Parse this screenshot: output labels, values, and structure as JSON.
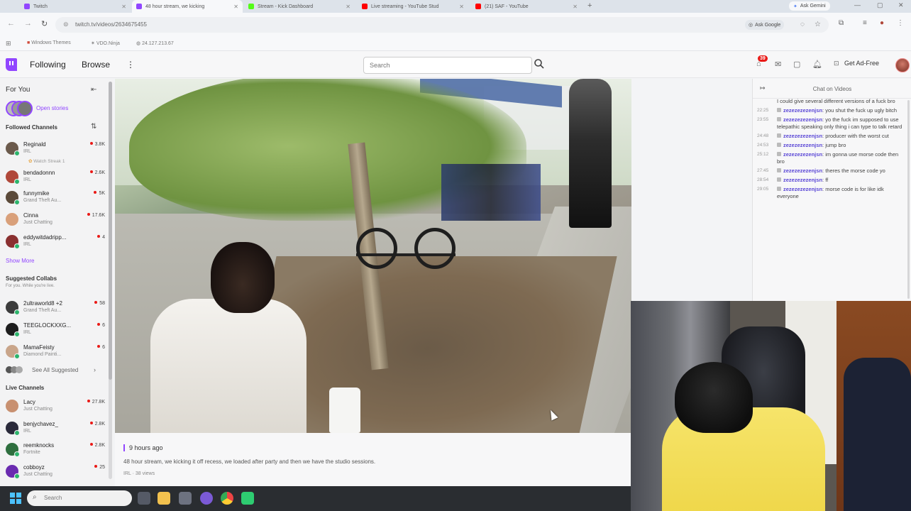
{
  "browser": {
    "tabs": [
      {
        "label": "Twitch",
        "active": false,
        "color": "#9146ff"
      },
      {
        "label": "48 hour stream, we kicking",
        "active": true,
        "color": "#9146ff"
      },
      {
        "label": "Stream - Kick Dashboard",
        "active": false,
        "color": "#53fc18"
      },
      {
        "label": "Live streaming - YouTube Stud",
        "active": false,
        "color": "#ff0000"
      },
      {
        "label": "(21) SAF - YouTube",
        "active": false,
        "color": "#ff0000"
      }
    ],
    "new_tab": "+",
    "ask_gemini": "Ask Gemini",
    "url": "twitch.tv/videos/2634675455",
    "ask_google": "Ask Google",
    "bookmarks": [
      {
        "label": "Windows Themes"
      },
      {
        "label": "VDO.Ninja"
      },
      {
        "label": "24.127.213.67"
      }
    ]
  },
  "twitch_nav": {
    "following": "Following",
    "browse": "Browse",
    "more": "⋮",
    "search_placeholder": "Search",
    "notif_count": "39",
    "ad_free": "Get Ad-Free"
  },
  "sidebar": {
    "for_you": "For You",
    "open_stories": "Open stories",
    "followed_title": "Followed Channels",
    "followed": [
      {
        "name": "Reginald",
        "game": "IRL",
        "extra": "Watch Streak 1",
        "viewers": "3.8K",
        "color": "#6b5a4c"
      },
      {
        "name": "bendadonnn",
        "game": "IRL",
        "viewers": "2.6K",
        "color": "#b0483a"
      },
      {
        "name": "funnymike",
        "game": "Grand Theft Au...",
        "viewers": "5K",
        "color": "#5b4a3a"
      },
      {
        "name": "Cinna",
        "game": "Just Chatting",
        "viewers": "17.6K",
        "color": "#d9a07a"
      },
      {
        "name": "eddywitdadripp...",
        "game": "IRL",
        "viewers": "4",
        "color": "#8a3030"
      }
    ],
    "show_more": "Show More",
    "suggested_title": "Suggested Collabs",
    "suggested_sub": "For you. While you're live.",
    "suggested": [
      {
        "name": "2ultraworld8 +2",
        "game": "Grand Theft Au...",
        "viewers": "58",
        "color": "#3c3c3c"
      },
      {
        "name": "TEEGLOCKXXG...",
        "game": "IRL",
        "viewers": "6",
        "color": "#1d1d1d"
      },
      {
        "name": "MamaFeisty",
        "game": "Diamond Painti...",
        "viewers": "6",
        "color": "#c9a58a"
      }
    ],
    "see_all": "See All Suggested",
    "live_title": "Live Channels",
    "live": [
      {
        "name": "Lacy",
        "game": "Just Chatting",
        "viewers": "27.8K",
        "color": "#c89070"
      },
      {
        "name": "benjychavez_",
        "game": "IRL",
        "viewers": "2.8K",
        "color": "#2a2a3a"
      },
      {
        "name": "reemknocks",
        "game": "Fortnite",
        "viewers": "2.8K",
        "color": "#2e6e3e"
      },
      {
        "name": "cobboyz",
        "game": "Just Chatting",
        "viewers": "25",
        "color": "#6a2bb0"
      }
    ]
  },
  "video_info": {
    "time_ago": "9 hours ago",
    "title": "48 hour stream, we kicking it off recess, we loaded after party and then we have the studio sessions.",
    "meta": "IRL · 38 views"
  },
  "chat": {
    "header": "Chat on Videos",
    "messages": [
      {
        "ts": "",
        "user": "",
        "text": "I could give several different versions of a fuck bro"
      },
      {
        "ts": "22:25",
        "user": "zezezezezenjsn",
        "text": ": you shut the fuck up ugly bitch"
      },
      {
        "ts": "23:55",
        "user": "zezezezezenjsn",
        "text": ": yo the fuck im supposed to use telepathic speaking only thing i can type to talk retard"
      },
      {
        "ts": "24:48",
        "user": "zezezezezenjsn",
        "text": ": producer with the worst cut"
      },
      {
        "ts": "24:53",
        "user": "zezezezezenjsn",
        "text": ": jump bro"
      },
      {
        "ts": "25:12",
        "user": "zezezezezenjsn",
        "text": ": im gonna use morse code then bro"
      },
      {
        "ts": "27:45",
        "user": "zezezezezenjsn",
        "text": ": theres the morse code yo"
      },
      {
        "ts": "28:54",
        "user": "zezezezezenjsn",
        "text": ": ff"
      },
      {
        "ts": "29:05",
        "user": "zezezezezenjsn",
        "text": ": morse code is for like idk everyone"
      }
    ]
  },
  "taskbar": {
    "search_placeholder": "Search"
  }
}
